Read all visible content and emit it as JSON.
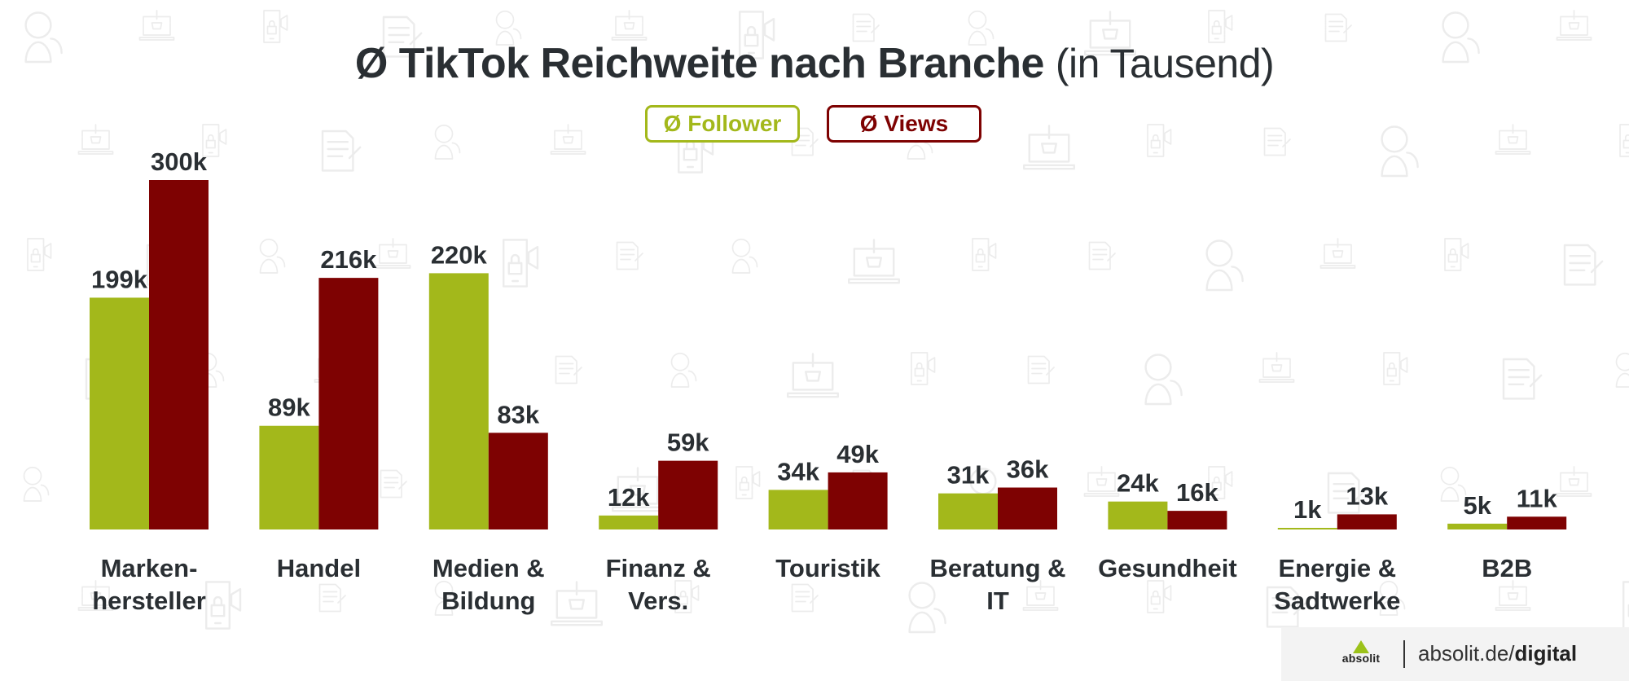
{
  "title": {
    "bold": "Ø TikTok Reichweite nach Branche",
    "light": "(in Tausend)"
  },
  "legend": [
    {
      "label": "Ø Follower",
      "color": "#a3b81b"
    },
    {
      "label": "Ø Views",
      "color": "#7e0202"
    }
  ],
  "footer": {
    "logo_text": "absolit",
    "site_light": "absolit.de/",
    "site_bold": "digital"
  },
  "colors": {
    "follower": "#a3b81b",
    "views": "#7e0202",
    "text": "#2a2f33"
  },
  "chart_data": {
    "type": "bar",
    "title": "Ø TikTok Reichweite nach Branche (in Tausend)",
    "xlabel": "",
    "ylabel": "",
    "ylim": [
      0,
      300
    ],
    "grid": false,
    "legend_position": "top-center",
    "categories": [
      [
        "Marken-",
        "hersteller"
      ],
      [
        "Handel"
      ],
      [
        "Medien &",
        "Bildung"
      ],
      [
        "Finanz &",
        "Vers."
      ],
      [
        "Touristik"
      ],
      [
        "Beratung &",
        "IT"
      ],
      [
        "Gesundheit"
      ],
      [
        "Energie &",
        "Sadtwerke"
      ],
      [
        "B2B"
      ]
    ],
    "series": [
      {
        "name": "Ø Follower",
        "values": [
          199,
          89,
          220,
          12,
          34,
          31,
          24,
          1,
          5
        ],
        "labels": [
          "199k",
          "89k",
          "220k",
          "12k",
          "34k",
          "31k",
          "24k",
          "1k",
          "5k"
        ]
      },
      {
        "name": "Ø Views",
        "values": [
          300,
          216,
          83,
          59,
          49,
          36,
          16,
          13,
          11
        ],
        "labels": [
          "300k",
          "216k",
          "83k",
          "59k",
          "49k",
          "36k",
          "16k",
          "13k",
          "11k"
        ]
      }
    ]
  }
}
